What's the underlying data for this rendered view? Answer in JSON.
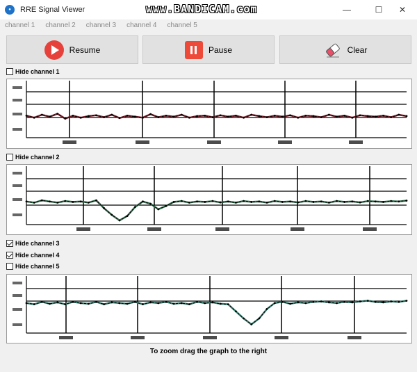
{
  "window": {
    "title": "RRE Signal Viewer",
    "watermark": "www.BANDICAM.com",
    "controls": {
      "minimize": "—",
      "maximize": "☐",
      "close": "✕"
    }
  },
  "menu": [
    "channel 1",
    "channel 2",
    "channel 3",
    "channel 4",
    "channel 5"
  ],
  "toolbar": {
    "resume_label": "Resume",
    "pause_label": "Pause",
    "clear_label": "Clear"
  },
  "channels": [
    {
      "label": "Hide channel 1",
      "checked": false
    },
    {
      "label": "Hide channel 2",
      "checked": false
    },
    {
      "label": "Hide channel 3",
      "checked": true
    },
    {
      "label": "Hide channel 4",
      "checked": true
    },
    {
      "label": "Hide channel 5",
      "checked": false
    }
  ],
  "colors": {
    "accent_red": "#e6423b",
    "trace_ch1": "#7a1f2b",
    "trace_ch2": "#2f6b4a",
    "trace_ch5": "#2f7a6a"
  },
  "chart_data": [
    {
      "type": "line",
      "series": [
        {
          "color": "#7a1f2b",
          "values": [
            0.2,
            0.1,
            0.25,
            0.15,
            0.3,
            0.05,
            0.2,
            0.1,
            0.18,
            0.22,
            0.12,
            0.25,
            0.08,
            0.2,
            0.15,
            0.1,
            0.28,
            0.12,
            0.2,
            0.15,
            0.25,
            0.1,
            0.18,
            0.2,
            0.12,
            0.22,
            0.15,
            0.2,
            0.1,
            0.25,
            0.18,
            0.12,
            0.2,
            0.15,
            0.22,
            0.1,
            0.2,
            0.18,
            0.12,
            0.25,
            0.15,
            0.2,
            0.1,
            0.22,
            0.18,
            0.15,
            0.2,
            0.12,
            0.25,
            0.18
          ]
        }
      ]
    },
    {
      "type": "line",
      "series": [
        {
          "color": "#2f6b4a",
          "values": [
            0.1,
            0.05,
            0.15,
            0.1,
            0.05,
            0.12,
            0.08,
            0.1,
            0.05,
            0.15,
            -0.2,
            -0.5,
            -0.75,
            -0.55,
            -0.15,
            0.1,
            0.0,
            -0.25,
            -0.1,
            0.08,
            0.12,
            0.05,
            0.1,
            0.08,
            0.12,
            0.06,
            0.1,
            0.05,
            0.12,
            0.08,
            0.1,
            0.05,
            0.12,
            0.08,
            0.1,
            0.06,
            0.12,
            0.08,
            0.1,
            0.05,
            0.12,
            0.08,
            0.1,
            0.06,
            0.12,
            0.1,
            0.08,
            0.12,
            0.1,
            0.14
          ]
        }
      ]
    },
    {
      "type": "line",
      "series": [
        {
          "color": "#2f7a6a",
          "values": [
            0.15,
            0.1,
            0.2,
            0.12,
            0.18,
            0.1,
            0.2,
            0.15,
            0.12,
            0.2,
            0.1,
            0.18,
            0.15,
            0.12,
            0.2,
            0.1,
            0.18,
            0.15,
            0.2,
            0.12,
            0.15,
            0.1,
            0.2,
            0.15,
            0.18,
            0.12,
            0.1,
            -0.2,
            -0.5,
            -0.75,
            -0.5,
            -0.1,
            0.15,
            0.2,
            0.12,
            0.18,
            0.15,
            0.2,
            0.22,
            0.18,
            0.15,
            0.2,
            0.18,
            0.22,
            0.25,
            0.2,
            0.18,
            0.22,
            0.2,
            0.25
          ]
        }
      ]
    }
  ],
  "hint": "To zoom drag the graph to the right"
}
